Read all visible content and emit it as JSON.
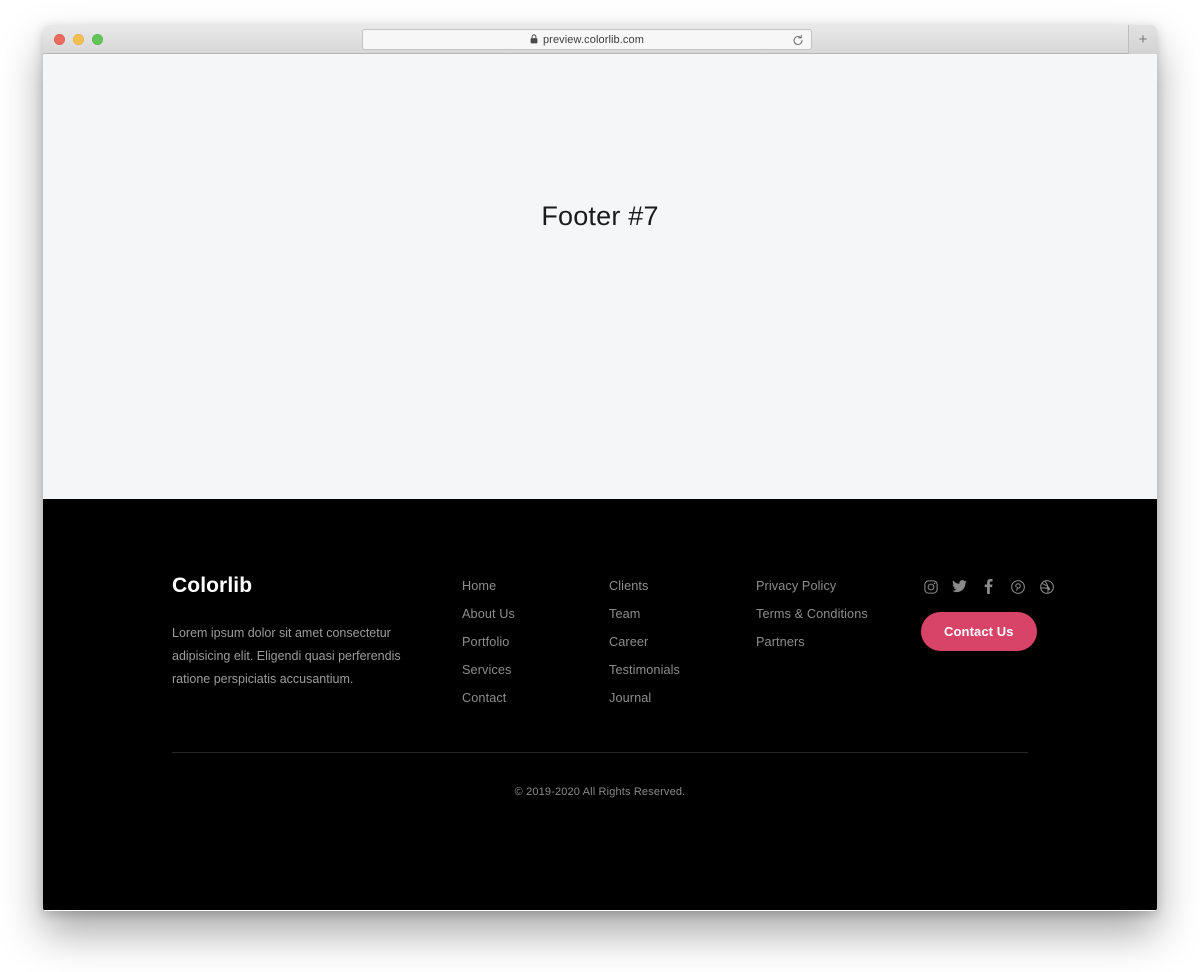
{
  "browser": {
    "traffic_lights": [
      {
        "name": "close",
        "color": "#ed6a5f"
      },
      {
        "name": "minimize",
        "color": "#f4bf4f"
      },
      {
        "name": "maximize",
        "color": "#61c554"
      }
    ],
    "url": "preview.colorlib.com",
    "lock_icon": "lock-icon",
    "reload_icon": "reload-icon",
    "new_tab_label": "+"
  },
  "hero": {
    "title": "Footer #7"
  },
  "footer": {
    "brand": {
      "name": "Colorlib",
      "description": "Lorem ipsum dolor sit amet consectetur adipisicing elit. Eligendi quasi perferendis ratione perspiciatis accusantium."
    },
    "columns": [
      {
        "links": [
          {
            "label": "Home"
          },
          {
            "label": "About Us"
          },
          {
            "label": "Portfolio"
          },
          {
            "label": "Services"
          },
          {
            "label": "Contact"
          }
        ]
      },
      {
        "links": [
          {
            "label": "Clients"
          },
          {
            "label": "Team"
          },
          {
            "label": "Career"
          },
          {
            "label": "Testimonials"
          },
          {
            "label": "Journal"
          }
        ]
      },
      {
        "links": [
          {
            "label": "Privacy Policy"
          },
          {
            "label": "Terms & Conditions"
          },
          {
            "label": "Partners"
          }
        ]
      }
    ],
    "social": [
      {
        "icon": "instagram-icon",
        "name": "Instagram"
      },
      {
        "icon": "twitter-icon",
        "name": "Twitter"
      },
      {
        "icon": "facebook-icon",
        "name": "Facebook"
      },
      {
        "icon": "pinterest-icon",
        "name": "Pinterest"
      },
      {
        "icon": "dribbble-icon",
        "name": "Dribbble"
      }
    ],
    "cta": {
      "label": "Contact Us",
      "color": "#d84368"
    },
    "copyright": "© 2019-2020 All Rights Reserved."
  },
  "colors": {
    "page_background": "#f5f6f8",
    "footer_background": "#000000",
    "accent": "#d84368",
    "muted_text": "#8d8d8d"
  }
}
